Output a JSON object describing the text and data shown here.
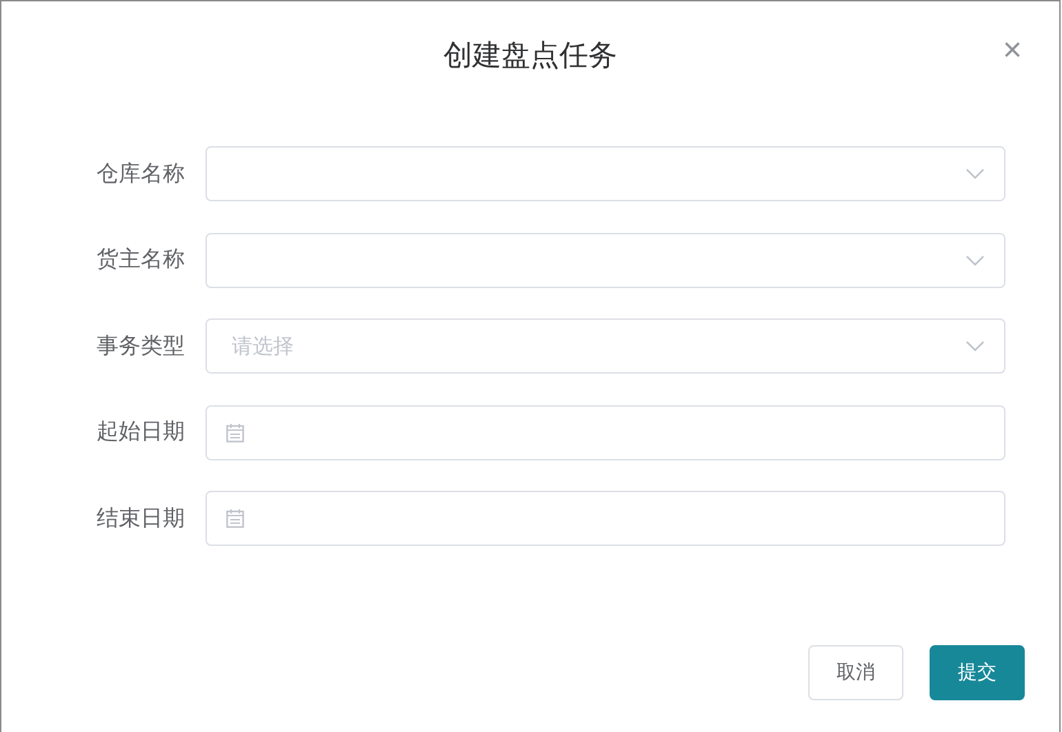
{
  "dialog": {
    "title": "创建盘点任务",
    "close": "×"
  },
  "fields": [
    {
      "label": "仓库名称",
      "kind": "select"
    },
    {
      "label": "货主名称",
      "kind": "select"
    },
    {
      "label": "事务类型",
      "kind": "select",
      "placeholder": "请选择"
    },
    {
      "label": "起始日期",
      "kind": "date"
    },
    {
      "label": "结束日期",
      "kind": "date"
    }
  ],
  "buttons": [
    {
      "label": "取消",
      "kind": "secondary"
    },
    {
      "label": "提交",
      "kind": "primary"
    }
  ]
}
